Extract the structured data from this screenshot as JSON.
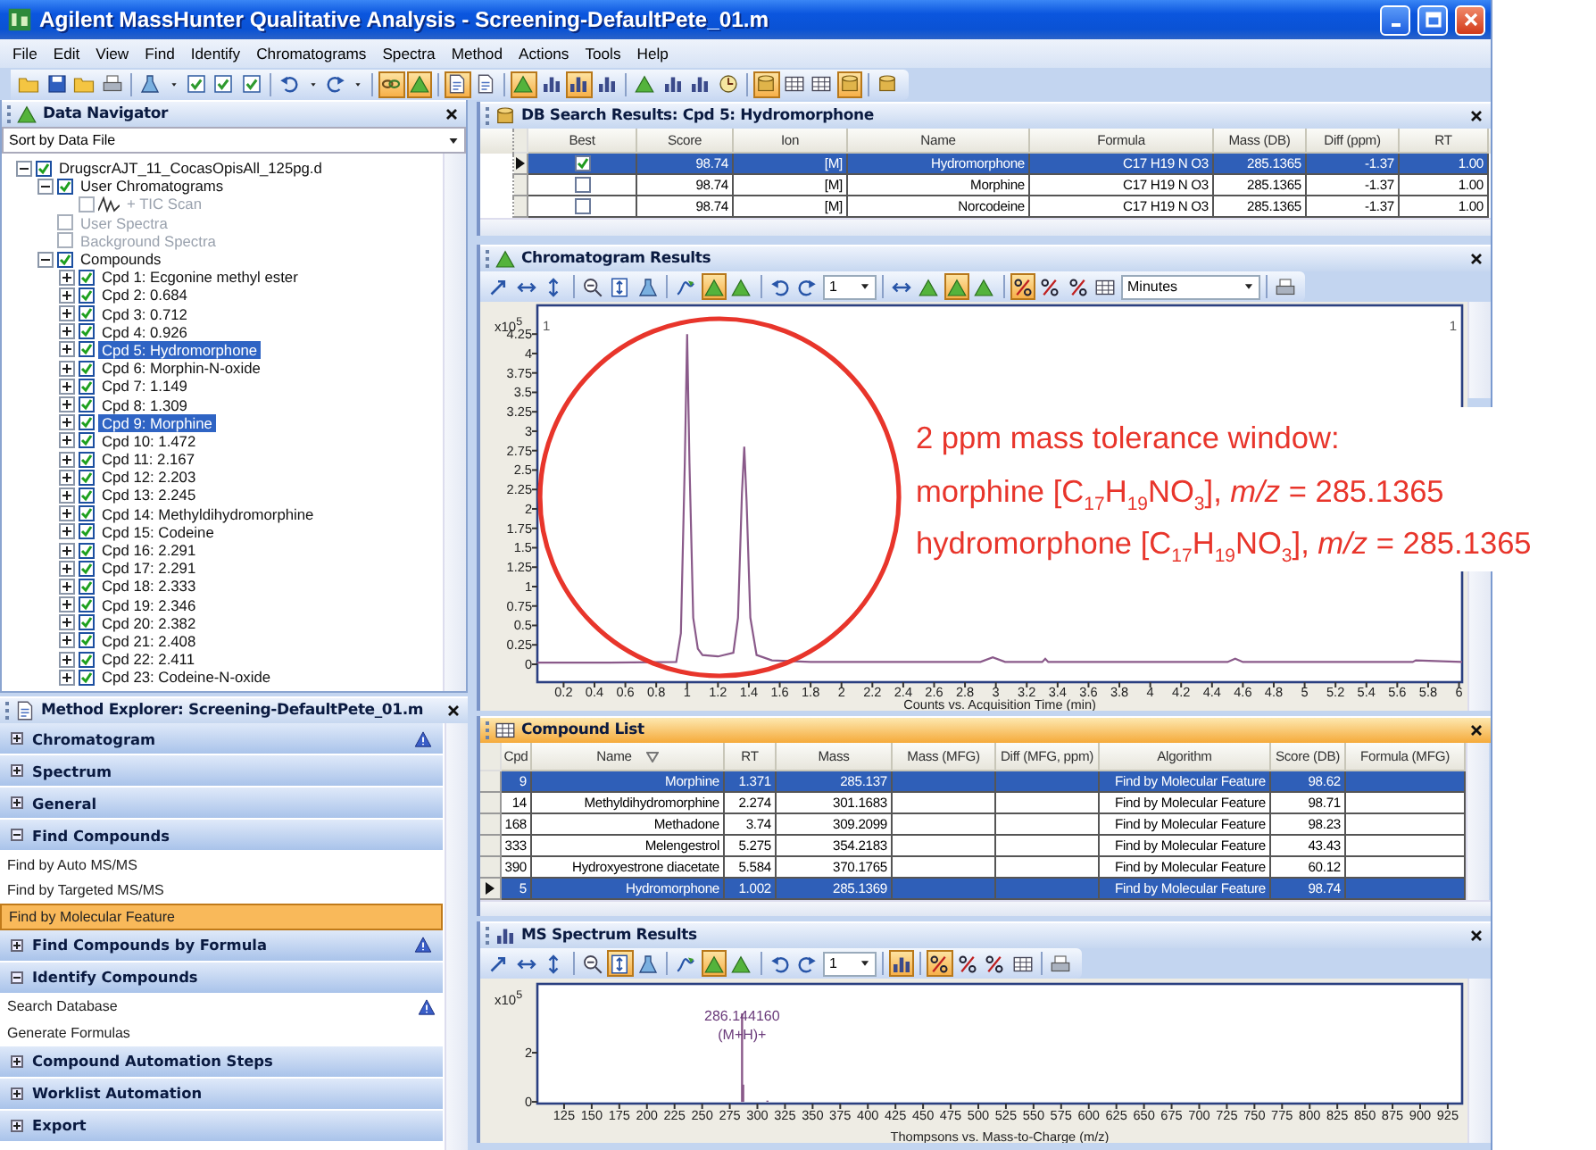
{
  "window": {
    "title": "Agilent MassHunter Qualitative Analysis - Screening-DefaultPete_01.m"
  },
  "menu": [
    "File",
    "Edit",
    "View",
    "Find",
    "Identify",
    "Chromatograms",
    "Spectra",
    "Method",
    "Actions",
    "Tools",
    "Help"
  ],
  "toolbar": {
    "buttons": [
      {
        "pressed": false
      },
      {
        "pressed": false
      },
      {
        "pressed": false
      },
      {
        "pressed": false
      },
      {
        "pressed": false
      },
      {
        "pressed": false
      },
      {
        "pressed": false
      },
      {
        "pressed": false
      },
      {
        "pressed": false
      },
      {
        "pressed": false
      },
      {
        "pressed": false
      },
      {
        "pressed": false
      },
      {
        "pressed": false
      },
      {
        "pressed": true
      },
      {
        "pressed": true
      },
      {
        "pressed": true
      },
      {
        "pressed": false
      },
      {
        "pressed": true
      },
      {
        "pressed": false
      },
      {
        "pressed": true
      },
      {
        "pressed": false
      },
      {
        "pressed": false
      },
      {
        "pressed": false
      },
      {
        "pressed": false
      },
      {
        "pressed": false
      },
      {
        "pressed": true
      },
      {
        "pressed": false
      },
      {
        "pressed": false
      },
      {
        "pressed": true
      },
      {
        "pressed": false
      }
    ]
  },
  "data_navigator": {
    "title": "Data Navigator",
    "active": false,
    "sort": "Sort by Data File",
    "tree": [
      {
        "label": "DrugscrAJT_11_CocasOpisAll_125pg.d",
        "checked": true,
        "expanded": true,
        "disabled": false,
        "selected": false,
        "children": [
          {
            "label": "User Chromatograms",
            "checked": true,
            "expanded": true,
            "disabled": false,
            "selected": false,
            "children": [
              {
                "label": "+ TIC Scan",
                "kind": "trace",
                "checked": false,
                "disabled": true,
                "selected": false
              }
            ]
          },
          {
            "label": "User Spectra",
            "checked": false,
            "disabled": true,
            "selected": false
          },
          {
            "label": "Background Spectra",
            "checked": false,
            "disabled": true,
            "selected": false
          },
          {
            "label": "Compounds",
            "checked": true,
            "expanded": true,
            "disabled": false,
            "selected": false,
            "children": [
              {
                "label": "Cpd 1: Ecgonine methyl ester",
                "checked": true,
                "expanded": false,
                "disabled": false,
                "selected": false
              },
              {
                "label": "Cpd 2: 0.684",
                "checked": true,
                "expanded": false,
                "disabled": false,
                "selected": false
              },
              {
                "label": "Cpd 3: 0.712",
                "checked": true,
                "expanded": false,
                "disabled": false,
                "selected": false
              },
              {
                "label": "Cpd 4: 0.926",
                "checked": true,
                "expanded": false,
                "disabled": false,
                "selected": false
              },
              {
                "label": "Cpd 5: Hydromorphone",
                "checked": true,
                "expanded": false,
                "disabled": false,
                "selected": true
              },
              {
                "label": "Cpd 6: Morphin-N-oxide",
                "checked": true,
                "expanded": false,
                "disabled": false,
                "selected": false
              },
              {
                "label": "Cpd 7: 1.149",
                "checked": true,
                "expanded": false,
                "disabled": false,
                "selected": false
              },
              {
                "label": "Cpd 8: 1.309",
                "checked": true,
                "expanded": false,
                "disabled": false,
                "selected": false
              },
              {
                "label": "Cpd 9: Morphine",
                "checked": true,
                "expanded": false,
                "disabled": false,
                "selected": true
              },
              {
                "label": "Cpd 10: 1.472",
                "checked": true,
                "expanded": false,
                "disabled": false,
                "selected": false
              },
              {
                "label": "Cpd 11: 2.167",
                "checked": true,
                "expanded": false,
                "disabled": false,
                "selected": false
              },
              {
                "label": "Cpd 12: 2.203",
                "checked": true,
                "expanded": false,
                "disabled": false,
                "selected": false
              },
              {
                "label": "Cpd 13: 2.245",
                "checked": true,
                "expanded": false,
                "disabled": false,
                "selected": false
              },
              {
                "label": "Cpd 14: Methyldihydromorphine",
                "checked": true,
                "expanded": false,
                "disabled": false,
                "selected": false
              },
              {
                "label": "Cpd 15: Codeine",
                "checked": true,
                "expanded": false,
                "disabled": false,
                "selected": false
              },
              {
                "label": "Cpd 16: 2.291",
                "checked": true,
                "expanded": false,
                "disabled": false,
                "selected": false
              },
              {
                "label": "Cpd 17: 2.291",
                "checked": true,
                "expanded": false,
                "disabled": false,
                "selected": false
              },
              {
                "label": "Cpd 18: 2.333",
                "checked": true,
                "expanded": false,
                "disabled": false,
                "selected": false
              },
              {
                "label": "Cpd 19: 2.346",
                "checked": true,
                "expanded": false,
                "disabled": false,
                "selected": false
              },
              {
                "label": "Cpd 20: 2.382",
                "checked": true,
                "expanded": false,
                "disabled": false,
                "selected": false
              },
              {
                "label": "Cpd 21: 2.408",
                "checked": true,
                "expanded": false,
                "disabled": false,
                "selected": false
              },
              {
                "label": "Cpd 22: 2.411",
                "checked": true,
                "expanded": false,
                "disabled": false,
                "selected": false
              },
              {
                "label": "Cpd 23: Codeine-N-oxide",
                "checked": true,
                "expanded": false,
                "disabled": false,
                "selected": false
              }
            ]
          }
        ]
      }
    ]
  },
  "method_explorer": {
    "title": "Method Explorer: Screening-DefaultPete_01.m",
    "active": false,
    "sections": [
      {
        "title": "Chromatogram",
        "expanded": false,
        "warning": true
      },
      {
        "title": "Spectrum",
        "expanded": false,
        "warning": false
      },
      {
        "title": "General",
        "expanded": false,
        "warning": false
      },
      {
        "title": "Find Compounds",
        "expanded": true,
        "warning": false,
        "items": [
          {
            "label": "Find by Auto MS/MS",
            "selected": false,
            "warning": false
          },
          {
            "label": "Find by Targeted MS/MS",
            "selected": false,
            "warning": false
          },
          {
            "label": "Find by Molecular Feature",
            "selected": true,
            "warning": false
          }
        ]
      },
      {
        "title": "Find Compounds by Formula",
        "expanded": false,
        "warning": true
      },
      {
        "title": "Identify Compounds",
        "expanded": true,
        "warning": false,
        "items": [
          {
            "label": "Search Database",
            "selected": false,
            "warning": true
          },
          {
            "label": "Generate Formulas",
            "selected": false,
            "warning": false
          }
        ]
      },
      {
        "title": "Compound Automation Steps",
        "expanded": false,
        "warning": false
      },
      {
        "title": "Worklist Automation",
        "expanded": false,
        "warning": false
      },
      {
        "title": "Export",
        "expanded": false,
        "warning": false
      }
    ]
  },
  "db_results": {
    "title": "DB Search Results: Cpd 5: Hydromorphone",
    "active": false,
    "columns": [
      "Best",
      "Score",
      "Ion",
      "Name",
      "Formula",
      "Mass (DB)",
      "Diff (ppm)",
      "RT"
    ],
    "rows": [
      {
        "current": true,
        "selected": true,
        "best": true,
        "score": "98.74",
        "ion": "[M]",
        "name": "Hydromorphone",
        "formula": "C17 H19 N O3",
        "mass_db": "285.1365",
        "diff_ppm": "-1.37",
        "rt": "1.00"
      },
      {
        "current": false,
        "selected": false,
        "best": false,
        "score": "98.74",
        "ion": "[M]",
        "name": "Morphine",
        "formula": "C17 H19 N O3",
        "mass_db": "285.1365",
        "diff_ppm": "-1.37",
        "rt": "1.00"
      },
      {
        "current": false,
        "selected": false,
        "best": false,
        "score": "98.74",
        "ion": "[M]",
        "name": "Norcodeine",
        "formula": "C17 H19 N O3",
        "mass_db": "285.1365",
        "diff_ppm": "-1.37",
        "rt": "1.00"
      }
    ]
  },
  "chromatogram": {
    "title": "Chromatogram Results",
    "active": false,
    "toolbar": {
      "buttons": [
        {
          "pressed": false
        },
        {
          "pressed": false
        },
        {
          "pressed": false
        },
        {
          "pressed": false
        },
        {
          "pressed": false
        },
        {
          "pressed": false
        },
        {
          "pressed": false
        },
        {
          "pressed": true
        },
        {
          "pressed": false
        },
        {
          "pressed": false
        },
        {
          "pressed": false
        },
        {
          "pressed": false
        },
        {
          "pressed": false
        },
        {
          "pressed": true
        },
        {
          "pressed": false
        },
        {
          "pressed": true
        },
        {
          "pressed": false
        },
        {
          "pressed": false
        },
        {
          "pressed": false
        },
        {
          "pressed": false
        }
      ],
      "selects": [
        {
          "value": "1"
        },
        {
          "value": "Minutes"
        }
      ]
    },
    "chart_data": {
      "type": "line",
      "xlabel": "Counts vs. Acquisition Time (min)",
      "ylabel": "x10$^{5}$",
      "x": [
        0.03,
        0.5,
        0.93,
        0.96,
        0.985,
        1.0,
        1.015,
        1.04,
        1.07,
        1.1,
        1.2,
        1.3,
        1.33,
        1.355,
        1.37,
        1.385,
        1.41,
        1.45,
        1.55,
        1.8,
        2.9,
        2.98,
        3.06,
        3.3,
        3.32,
        3.34,
        4.5,
        4.55,
        4.6,
        5.7,
        5.72,
        6.02
      ],
      "series": [
        {
          "color": "#8a5a8a",
          "values": [
            0.02,
            0.02,
            0.03,
            0.4,
            2.6,
            4.25,
            2.6,
            0.6,
            0.2,
            0.12,
            0.1,
            0.15,
            0.6,
            2.2,
            2.8,
            2.1,
            0.6,
            0.12,
            0.05,
            0.03,
            0.03,
            0.09,
            0.03,
            0.03,
            0.07,
            0.03,
            0.03,
            0.07,
            0.03,
            0.03,
            0.05,
            0.03
          ]
        }
      ],
      "xlim": [
        0.03,
        6.02
      ],
      "ylim": [
        -0.23,
        4.62
      ],
      "xticks": [
        0.2,
        0.4,
        0.6,
        0.8,
        1,
        1.2,
        1.4,
        1.6,
        1.8,
        2,
        2.2,
        2.4,
        2.6,
        2.8,
        3,
        3.2,
        3.4,
        3.6,
        3.8,
        4,
        4.2,
        4.4,
        4.6,
        4.8,
        5,
        5.2,
        5.4,
        5.6,
        5.8,
        6
      ],
      "yticks": [
        0,
        0.25,
        0.5,
        0.75,
        1,
        1.25,
        1.5,
        1.75,
        2,
        2.25,
        2.5,
        2.75,
        3,
        3.25,
        3.5,
        3.75,
        4,
        4.25
      ],
      "annotations": [
        "1",
        "1"
      ]
    }
  },
  "compound_list": {
    "title": "Compound List",
    "active": true,
    "columns": [
      "Cpd",
      "Name",
      "RT",
      "Mass",
      "Mass (MFG)",
      "Diff (MFG, ppm)",
      "Algorithm",
      "Score (DB)",
      "Formula (MFG)"
    ],
    "rows": [
      {
        "current": false,
        "selected": true,
        "cpd": "9",
        "name": "Morphine",
        "rt": "1.371",
        "mass": "285.137",
        "algorithm": "Find by Molecular Feature",
        "score_db": "98.62"
      },
      {
        "current": false,
        "selected": false,
        "cpd": "14",
        "name": "Methyldihydromorphine",
        "rt": "2.274",
        "mass": "301.1683",
        "algorithm": "Find by Molecular Feature",
        "score_db": "98.71"
      },
      {
        "current": false,
        "selected": false,
        "cpd": "168",
        "name": "Methadone",
        "rt": "3.74",
        "mass": "309.2099",
        "algorithm": "Find by Molecular Feature",
        "score_db": "98.23"
      },
      {
        "current": false,
        "selected": false,
        "cpd": "333",
        "name": "Melengestrol",
        "rt": "5.275",
        "mass": "354.2183",
        "algorithm": "Find by Molecular Feature",
        "score_db": "43.43"
      },
      {
        "current": false,
        "selected": false,
        "cpd": "390",
        "name": "Hydroxyestrone diacetate",
        "rt": "5.584",
        "mass": "370.1765",
        "algorithm": "Find by Molecular Feature",
        "score_db": "60.12"
      },
      {
        "current": true,
        "selected": true,
        "cpd": "5",
        "name": "Hydromorphone",
        "rt": "1.002",
        "mass": "285.1369",
        "algorithm": "Find by Molecular Feature",
        "score_db": "98.74"
      }
    ]
  },
  "ms_spectrum": {
    "title": "MS Spectrum Results",
    "active": false,
    "toolbar": {
      "buttons": [
        {
          "pressed": false
        },
        {
          "pressed": false
        },
        {
          "pressed": false
        },
        {
          "pressed": false
        },
        {
          "pressed": true
        },
        {
          "pressed": false
        },
        {
          "pressed": false
        },
        {
          "pressed": true
        },
        {
          "pressed": false
        },
        {
          "pressed": false
        },
        {
          "pressed": false
        },
        {
          "pressed": true
        },
        {
          "pressed": true
        },
        {
          "pressed": false
        },
        {
          "pressed": false
        },
        {
          "pressed": false
        },
        {
          "pressed": false
        }
      ],
      "selects": [
        {
          "value": "1"
        }
      ]
    },
    "chart_data": {
      "type": "bar",
      "xlabel": "Thompsons vs. Mass-to-Charge (m/z)",
      "ylabel": "x10$^{5}$",
      "x": [
        286.14,
        287.15,
        309.1
      ],
      "series": [
        {
          "color": "#8a5a8a",
          "values": [
            3.6,
            0.7,
            0.05
          ]
        }
      ],
      "xlim": [
        100.8,
        938
      ],
      "ylim": [
        -0.07,
        4.8
      ],
      "xticks": [
        125,
        150,
        175,
        200,
        225,
        250,
        275,
        300,
        325,
        350,
        375,
        400,
        425,
        450,
        475,
        500,
        525,
        550,
        575,
        600,
        625,
        650,
        675,
        700,
        725,
        750,
        775,
        800,
        825,
        850,
        875,
        900,
        925
      ],
      "yticks": [
        0,
        2
      ],
      "annotations": [
        {
          "x": 286.14,
          "y": 3.3,
          "text": "286.144160"
        },
        {
          "x": 286.14,
          "y": 2.55,
          "text": "(M+H)+"
        }
      ]
    }
  },
  "annotation": {
    "lines": [
      "2 ppm mass tolerance window:",
      "morphine [C$_{17}$H$_{19}$NO$_{3}$], *m/z* = 285.1365",
      "hydromorphone [C$_{17}$H$_{19}$NO$_{3}$], *m/z* = 285.1365"
    ]
  }
}
